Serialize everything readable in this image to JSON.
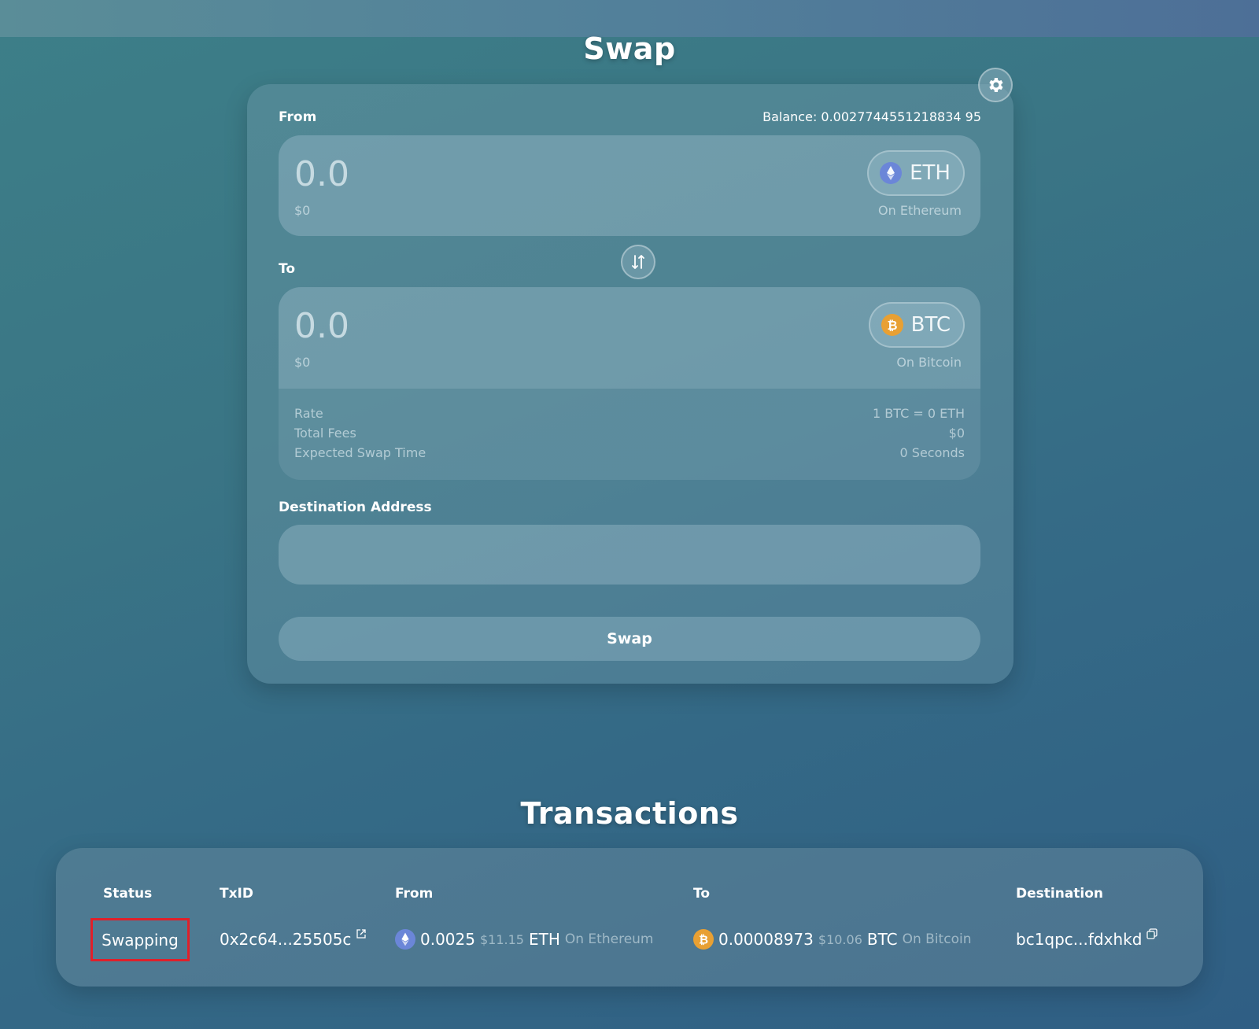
{
  "header": {
    "title": "Swap"
  },
  "swap": {
    "from_label": "From",
    "balance": "Balance: 0.0027744551218834 95",
    "from": {
      "amount": "0.0",
      "usd": "$0",
      "token": "ETH",
      "chain": "On Ethereum"
    },
    "to_label": "To",
    "to": {
      "amount": "0.0",
      "usd": "$0",
      "token": "BTC",
      "chain": "On Bitcoin"
    },
    "rates": [
      {
        "label": "Rate",
        "value": "1 BTC = 0 ETH"
      },
      {
        "label": "Total Fees",
        "value": "$0"
      },
      {
        "label": "Expected Swap Time",
        "value": "0 Seconds"
      }
    ],
    "destination_label": "Destination Address",
    "destination_value": "",
    "swap_button": "Swap"
  },
  "transactions": {
    "title": "Transactions",
    "columns": [
      "Status",
      "TxID",
      "From",
      "To",
      "Destination"
    ],
    "rows": [
      {
        "status": "Swapping",
        "txid": "0x2c64...25505c",
        "from_amount": "0.0025",
        "from_usd": "$11.15",
        "from_token": "ETH",
        "from_chain": "On Ethereum",
        "to_amount": "0.00008973",
        "to_usd": "$10.06",
        "to_token": "BTC",
        "to_chain": "On Bitcoin",
        "destination": "bc1qpc...fdxhkd"
      }
    ]
  },
  "colors": {
    "status_highlight": "#e0202a",
    "eth": "#6b86d8",
    "btc": "#e8a033"
  },
  "icons": [
    "gear-icon",
    "swap-direction-icon",
    "eth-icon",
    "btc-icon",
    "external-link-icon",
    "copy-icon"
  ]
}
